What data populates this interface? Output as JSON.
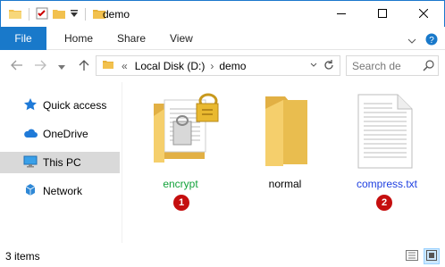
{
  "window": {
    "title": "demo"
  },
  "ribbon": {
    "tabs": [
      "File",
      "Home",
      "Share",
      "View"
    ]
  },
  "address": {
    "prefix": "«",
    "segments": [
      "Local Disk (D:)",
      "demo"
    ],
    "separator": "›"
  },
  "search": {
    "placeholder": "Search de"
  },
  "sidebar": {
    "items": [
      {
        "label": "Quick access",
        "icon": "star-icon"
      },
      {
        "label": "OneDrive",
        "icon": "cloud-icon"
      },
      {
        "label": "This PC",
        "icon": "computer-icon",
        "selected": true
      },
      {
        "label": "Network",
        "icon": "network-icon"
      }
    ]
  },
  "files": [
    {
      "name": "encrypt",
      "type": "folder-locked",
      "color": "#12a23a",
      "badge": "1"
    },
    {
      "name": "normal",
      "type": "folder",
      "color": "#000000"
    },
    {
      "name": "compress.txt",
      "type": "text-file",
      "color": "#1e3fe0",
      "badge": "2"
    }
  ],
  "status": {
    "count": "3 items"
  },
  "colors": {
    "accent": "#1979ca",
    "badge": "#c50e0e",
    "selected": "#d9d9d9"
  }
}
